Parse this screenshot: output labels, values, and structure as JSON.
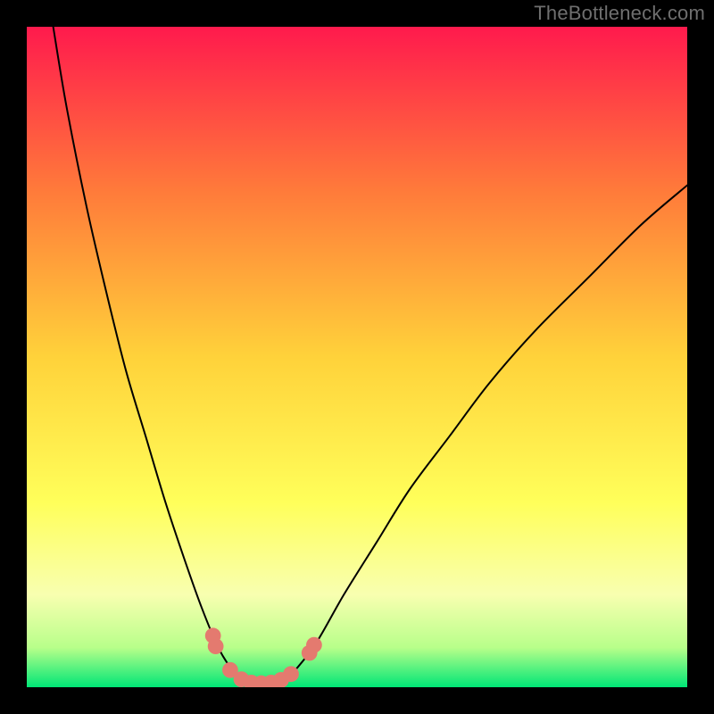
{
  "watermark": "TheBottleneck.com",
  "chart_data": {
    "type": "line",
    "title": "",
    "xlabel": "",
    "ylabel": "",
    "xlim": [
      0,
      100
    ],
    "ylim": [
      0,
      100
    ],
    "background_gradient_stops": [
      {
        "offset": 0,
        "color": "#ff1a4d"
      },
      {
        "offset": 25,
        "color": "#ff7b3a"
      },
      {
        "offset": 50,
        "color": "#ffd23a"
      },
      {
        "offset": 72,
        "color": "#ffff5a"
      },
      {
        "offset": 86,
        "color": "#f8ffb0"
      },
      {
        "offset": 94,
        "color": "#b8ff8a"
      },
      {
        "offset": 100,
        "color": "#00e676"
      }
    ],
    "series": [
      {
        "name": "bottleneck-curve",
        "color": "#000000",
        "points": [
          {
            "x": 4.0,
            "y": 100.0
          },
          {
            "x": 6.0,
            "y": 88.0
          },
          {
            "x": 9.0,
            "y": 73.0
          },
          {
            "x": 12.0,
            "y": 60.0
          },
          {
            "x": 15.0,
            "y": 48.0
          },
          {
            "x": 18.0,
            "y": 38.0
          },
          {
            "x": 21.0,
            "y": 28.0
          },
          {
            "x": 24.0,
            "y": 19.0
          },
          {
            "x": 26.5,
            "y": 12.0
          },
          {
            "x": 29.0,
            "y": 6.0
          },
          {
            "x": 31.0,
            "y": 2.8
          },
          {
            "x": 33.0,
            "y": 1.0
          },
          {
            "x": 35.0,
            "y": 0.5
          },
          {
            "x": 37.0,
            "y": 0.5
          },
          {
            "x": 39.0,
            "y": 1.2
          },
          {
            "x": 41.0,
            "y": 3.0
          },
          {
            "x": 44.0,
            "y": 7.0
          },
          {
            "x": 48.0,
            "y": 14.0
          },
          {
            "x": 53.0,
            "y": 22.0
          },
          {
            "x": 58.0,
            "y": 30.0
          },
          {
            "x": 64.0,
            "y": 38.0
          },
          {
            "x": 70.0,
            "y": 46.0
          },
          {
            "x": 77.0,
            "y": 54.0
          },
          {
            "x": 85.0,
            "y": 62.0
          },
          {
            "x": 93.0,
            "y": 70.0
          },
          {
            "x": 100.0,
            "y": 76.0
          }
        ]
      }
    ],
    "markers": {
      "name": "highlight-points",
      "color": "#e47a6f",
      "radius_pct": 1.2,
      "points": [
        {
          "x": 28.2,
          "y": 7.8
        },
        {
          "x": 28.6,
          "y": 6.2
        },
        {
          "x": 30.8,
          "y": 2.6
        },
        {
          "x": 32.5,
          "y": 1.2
        },
        {
          "x": 34.0,
          "y": 0.7
        },
        {
          "x": 35.5,
          "y": 0.6
        },
        {
          "x": 37.0,
          "y": 0.7
        },
        {
          "x": 38.5,
          "y": 1.1
        },
        {
          "x": 40.0,
          "y": 2.0
        },
        {
          "x": 42.8,
          "y": 5.2
        },
        {
          "x": 43.5,
          "y": 6.4
        }
      ]
    }
  }
}
